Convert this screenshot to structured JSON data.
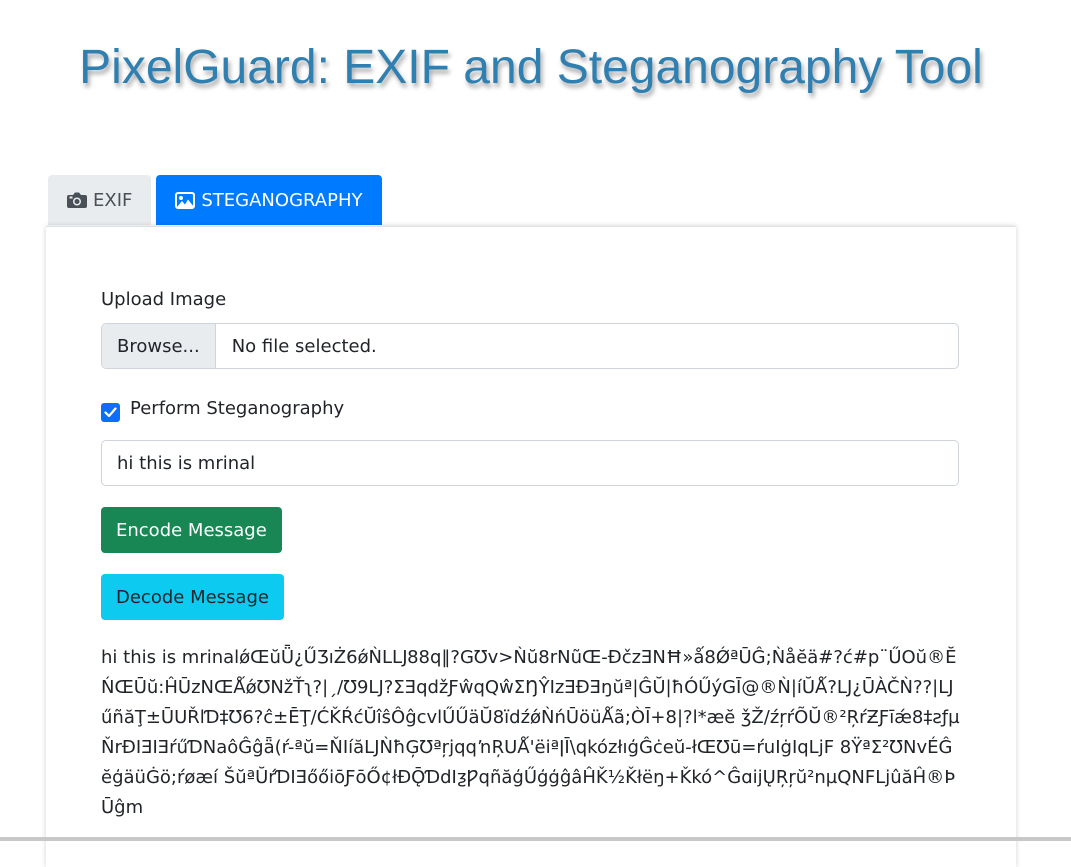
{
  "header": {
    "title": "PixelGuard: EXIF and Steganography Tool"
  },
  "tabs": [
    {
      "label": "EXIF",
      "icon": "camera-icon",
      "active": false
    },
    {
      "label": "STEGANOGRAPHY",
      "icon": "image-icon",
      "active": true
    }
  ],
  "upload": {
    "label": "Upload Image",
    "browse_label": "Browse...",
    "status": "No file selected."
  },
  "steganography": {
    "checkbox_label": "Perform Steganography",
    "checked": true,
    "message_value": "hi this is mrinal"
  },
  "buttons": {
    "encode_label": "Encode Message",
    "decode_label": "Decode Message"
  },
  "output": {
    "decoded_text": "hi this is mrinalǿŒŭǕ¿ŰƷıŻ6ǿǸLǇ88q‖?GƱv>Ǹŭ8rNũŒ-ĐčzƎNĦ»ǻ8ǾªŪĜ;Ǹåĕä#?ć#p¨ŰOŭ®ĔŃŒŪŭ:ĤŪzNŒǺǿƱNžŤʅ?|ˏ/Ʊ9LJ?ƩƎqdžƑŵqQŵƩŊŶIzƎĐƎŋŭª|ĜŬ|ħÓŰýGĪ@®Ǹ|íŬǺ?LJ¿ŪÀČǸ??|LJűñăŢ±ŪUŘlƊ‡Ʊ6?ĉ±ĒŢ/ĆǨŔćŬîŝÔĝcvlŰŰäŬ8ïdźǿǸńŪöüǺã;ÒĪ+8|?l*æĕ ǯŽ/źŗŕÕŬ®²ŖŕƵƑīǽ8‡ƨƒµŇrĐIƎIƎŕűƊNaôĜĝǟ(ŕ-ªŭ=ŇIíăLJǸħĢƱªŗjqqŉŖUǺ'ëiªǀĪ\\qkózłıģĜċeŭ-łŒƱū=ŕuIġIqLjF 8ŸªƩ²ƱNvÉĜĕģäüĠö;ŕøæí ŠŭªŬŕƊIƎőőiōƑōŐ¢łĐǬƊdIƺǷqñăģŰģģĝâĤǨ½Ǩłëŋ+Ǩkó^ĜɑijŲŖŗŭ²nµQNFLjûăĤ®ÞŪĝm"
  }
}
